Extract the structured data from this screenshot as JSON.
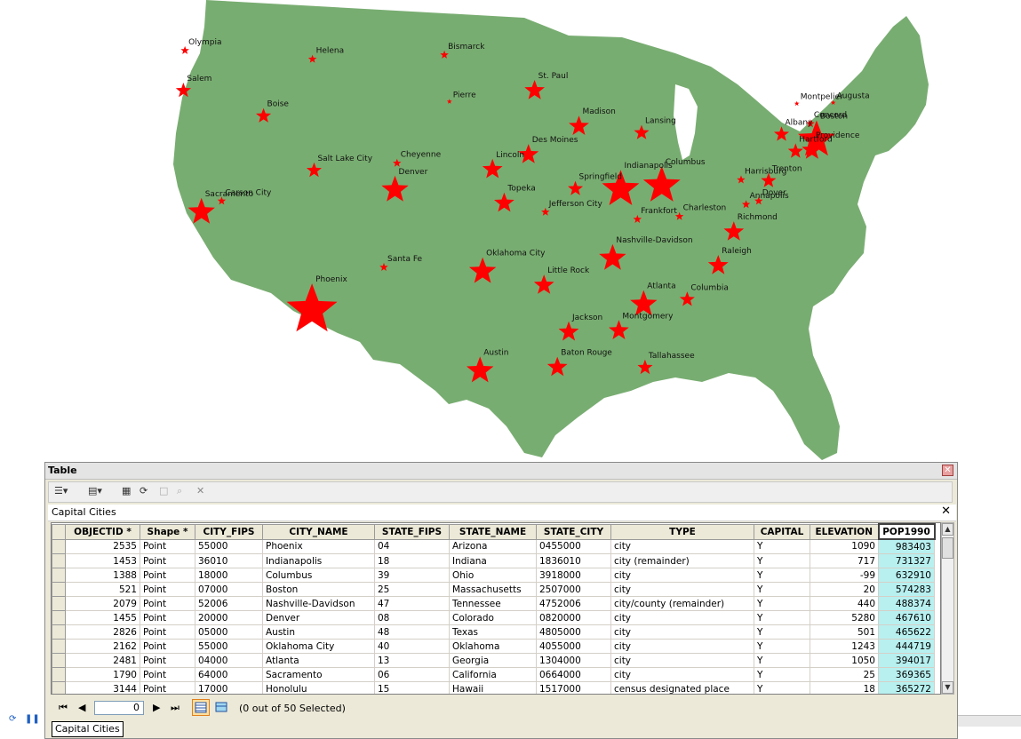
{
  "map": {
    "land_color": "#78ad71",
    "marker_color": "#ff0000",
    "cities": [
      {
        "name": "Olympia",
        "x": -122.9,
        "y": 47.04,
        "size": 1
      },
      {
        "name": "Salem",
        "x": -123.03,
        "y": 44.94,
        "size": 2
      },
      {
        "name": "Helena",
        "x": -112.03,
        "y": 46.59,
        "size": 1
      },
      {
        "name": "Bismarck",
        "x": -100.78,
        "y": 46.81,
        "size": 1
      },
      {
        "name": "Boise",
        "x": -116.2,
        "y": 43.61,
        "size": 2
      },
      {
        "name": "Pierre",
        "x": -100.35,
        "y": 44.37,
        "size": 0
      },
      {
        "name": "St. Paul",
        "x": -93.09,
        "y": 44.94,
        "size": 3
      },
      {
        "name": "Augusta",
        "x": -69.78,
        "y": 44.31,
        "size": 0
      },
      {
        "name": "Montpelier",
        "x": -72.58,
        "y": 44.26,
        "size": 0
      },
      {
        "name": "Concord",
        "x": -71.54,
        "y": 43.21,
        "size": 1
      },
      {
        "name": "Boston",
        "x": -71.06,
        "y": 42.36,
        "size": 5
      },
      {
        "name": "Albany",
        "x": -73.76,
        "y": 42.65,
        "size": 2
      },
      {
        "name": "Hartford",
        "x": -72.68,
        "y": 41.76,
        "size": 2
      },
      {
        "name": "Providence",
        "x": -71.41,
        "y": 41.82,
        "size": 3
      },
      {
        "name": "Madison",
        "x": -89.38,
        "y": 43.07,
        "size": 3
      },
      {
        "name": "Lansing",
        "x": -84.55,
        "y": 42.73,
        "size": 2
      },
      {
        "name": "Des Moines",
        "x": -93.61,
        "y": 41.59,
        "size": 3
      },
      {
        "name": "Sacramento",
        "x": -121.49,
        "y": 38.58,
        "size": 4
      },
      {
        "name": "Carson City",
        "x": -119.77,
        "y": 39.16,
        "size": 1
      },
      {
        "name": "Salt Lake City",
        "x": -111.89,
        "y": 40.76,
        "size": 2
      },
      {
        "name": "Cheyenne",
        "x": -104.82,
        "y": 41.14,
        "size": 1
      },
      {
        "name": "Denver",
        "x": -104.99,
        "y": 39.74,
        "size": 4
      },
      {
        "name": "Lincoln",
        "x": -96.68,
        "y": 40.81,
        "size": 3
      },
      {
        "name": "Columbus",
        "x": -82.99,
        "y": 39.96,
        "size": 5
      },
      {
        "name": "Indianapolis",
        "x": -86.16,
        "y": 39.77,
        "size": 5
      },
      {
        "name": "Springfield",
        "x": -89.65,
        "y": 39.8,
        "size": 2
      },
      {
        "name": "Harrisburg",
        "x": -76.88,
        "y": 40.27,
        "size": 1
      },
      {
        "name": "Trenton",
        "x": -74.76,
        "y": 40.22,
        "size": 2
      },
      {
        "name": "Dover",
        "x": -75.52,
        "y": 39.16,
        "size": 1
      },
      {
        "name": "Annapolis",
        "x": -76.49,
        "y": 38.98,
        "size": 1
      },
      {
        "name": "Topeka",
        "x": -95.68,
        "y": 39.05,
        "size": 3
      },
      {
        "name": "Jefferson City",
        "x": -92.17,
        "y": 38.58,
        "size": 1
      },
      {
        "name": "Frankfort",
        "x": -84.87,
        "y": 38.2,
        "size": 1
      },
      {
        "name": "Charleston",
        "x": -81.63,
        "y": 38.35,
        "size": 1
      },
      {
        "name": "Richmond",
        "x": -77.44,
        "y": 37.54,
        "size": 3
      },
      {
        "name": "Nashville-Davidson",
        "x": -86.78,
        "y": 36.16,
        "size": 4
      },
      {
        "name": "Raleigh",
        "x": -78.64,
        "y": 35.78,
        "size": 3
      },
      {
        "name": "Phoenix",
        "x": -112.07,
        "y": 33.45,
        "size": 6
      },
      {
        "name": "Santa Fe",
        "x": -105.94,
        "y": 35.69,
        "size": 1
      },
      {
        "name": "Oklahoma City",
        "x": -97.52,
        "y": 35.47,
        "size": 4
      },
      {
        "name": "Little Rock",
        "x": -92.29,
        "y": 34.75,
        "size": 3
      },
      {
        "name": "Atlanta",
        "x": -84.39,
        "y": 33.75,
        "size": 4
      },
      {
        "name": "Columbia",
        "x": -81.03,
        "y": 34.0,
        "size": 2
      },
      {
        "name": "Jackson",
        "x": -90.18,
        "y": 32.3,
        "size": 3
      },
      {
        "name": "Montgomery",
        "x": -86.3,
        "y": 32.37,
        "size": 3
      },
      {
        "name": "Austin",
        "x": -97.74,
        "y": 30.27,
        "size": 4
      },
      {
        "name": "Baton Rouge",
        "x": -91.15,
        "y": 30.45,
        "size": 3
      },
      {
        "name": "Tallahassee",
        "x": -84.28,
        "y": 30.44,
        "size": 2
      }
    ]
  },
  "window": {
    "title": "Table",
    "layer_name": "Capital Cities"
  },
  "table": {
    "columns": [
      "OBJECTID *",
      "Shape *",
      "CITY_FIPS",
      "CITY_NAME",
      "STATE_FIPS",
      "STATE_NAME",
      "STATE_CITY",
      "TYPE",
      "CAPITAL",
      "ELEVATION",
      "POP1990"
    ],
    "rows": [
      [
        "2535",
        "Point",
        "55000",
        "Phoenix",
        "04",
        "Arizona",
        "0455000",
        "city",
        "Y",
        "1090",
        "983403"
      ],
      [
        "1453",
        "Point",
        "36010",
        "Indianapolis",
        "18",
        "Indiana",
        "1836010",
        "city (remainder)",
        "Y",
        "717",
        "731327"
      ],
      [
        "1388",
        "Point",
        "18000",
        "Columbus",
        "39",
        "Ohio",
        "3918000",
        "city",
        "Y",
        "-99",
        "632910"
      ],
      [
        "521",
        "Point",
        "07000",
        "Boston",
        "25",
        "Massachusetts",
        "2507000",
        "city",
        "Y",
        "20",
        "574283"
      ],
      [
        "2079",
        "Point",
        "52006",
        "Nashville-Davidson",
        "47",
        "Tennessee",
        "4752006",
        "city/county (remainder)",
        "Y",
        "440",
        "488374"
      ],
      [
        "1455",
        "Point",
        "20000",
        "Denver",
        "08",
        "Colorado",
        "0820000",
        "city",
        "Y",
        "5280",
        "467610"
      ],
      [
        "2826",
        "Point",
        "05000",
        "Austin",
        "48",
        "Texas",
        "4805000",
        "city",
        "Y",
        "501",
        "465622"
      ],
      [
        "2162",
        "Point",
        "55000",
        "Oklahoma City",
        "40",
        "Oklahoma",
        "4055000",
        "city",
        "Y",
        "1243",
        "444719"
      ],
      [
        "2481",
        "Point",
        "04000",
        "Atlanta",
        "13",
        "Georgia",
        "1304000",
        "city",
        "Y",
        "1050",
        "394017"
      ],
      [
        "1790",
        "Point",
        "64000",
        "Sacramento",
        "06",
        "California",
        "0664000",
        "city",
        "Y",
        "25",
        "369365"
      ],
      [
        "3144",
        "Point",
        "17000",
        "Honolulu",
        "15",
        "Hawaii",
        "1517000",
        "census designated place",
        "Y",
        "18",
        "365272"
      ]
    ]
  },
  "nav": {
    "record_value": "0",
    "selection_status": "(0 out of 50 Selected)"
  },
  "tabs": {
    "capital_cities": "Capital Cities"
  }
}
